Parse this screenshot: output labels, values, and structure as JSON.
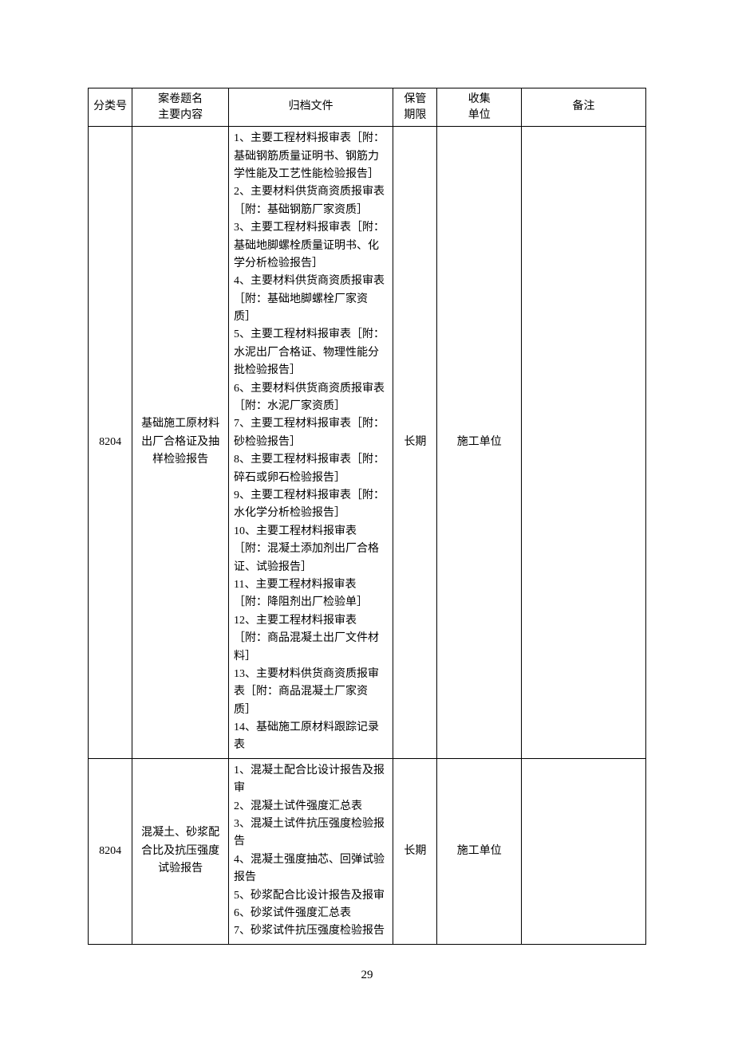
{
  "table": {
    "headers": {
      "col1": "分类号",
      "col2_line1": "案卷题名",
      "col2_line2": "主要内容",
      "col3": "归档文件",
      "col4_line1": "保管",
      "col4_line2": "期限",
      "col5_line1": "收集",
      "col5_line2": "单位",
      "col6": "备注"
    },
    "rows": [
      {
        "id": "8204",
        "title": "基础施工原材料出厂合格证及抽样检验报告",
        "file": "1、主要工程材料报审表［附：基础钢筋质量证明书、钢筋力学性能及工艺性能检验报告］\n2、主要材料供货商资质报审表［附：基础钢筋厂家资质］\n3、主要工程材料报审表［附：基础地脚螺栓质量证明书、化学分析检验报告］\n4、主要材料供货商资质报审表［附：基础地脚螺栓厂家资质］\n5、主要工程材料报审表［附：水泥出厂合格证、物理性能分批检验报告］\n6、主要材料供货商资质报审表［附：水泥厂家资质］\n7、主要工程材料报审表［附：砂检验报告］\n8、主要工程材料报审表［附：碎石或卵石检验报告］\n9、主要工程材料报审表［附：水化学分析检验报告］\n10、主要工程材料报审表［附：混凝土添加剂出厂合格证、试验报告］\n11、主要工程材料报审表［附：降阻剂出厂检验单］\n12、主要工程材料报审表［附：商品混凝土出厂文件材料］\n13、主要材料供货商资质报审表［附：商品混凝土厂家资质］\n14、基础施工原材料跟踪记录表",
        "period": "长期",
        "unit": "施工单位",
        "remark": ""
      },
      {
        "id": "8204",
        "title": "混凝土、砂浆配合比及抗压强度试验报告",
        "file": "1、混凝土配合比设计报告及报审\n2、混凝土试件强度汇总表\n3、混凝土试件抗压强度检验报告\n4、混凝土强度抽芯、回弹试验报告\n5、砂浆配合比设计报告及报审\n6、砂浆试件强度汇总表\n7、砂浆试件抗压强度检验报告",
        "period": "长期",
        "unit": "施工单位",
        "remark": ""
      }
    ]
  },
  "page_number": "29"
}
